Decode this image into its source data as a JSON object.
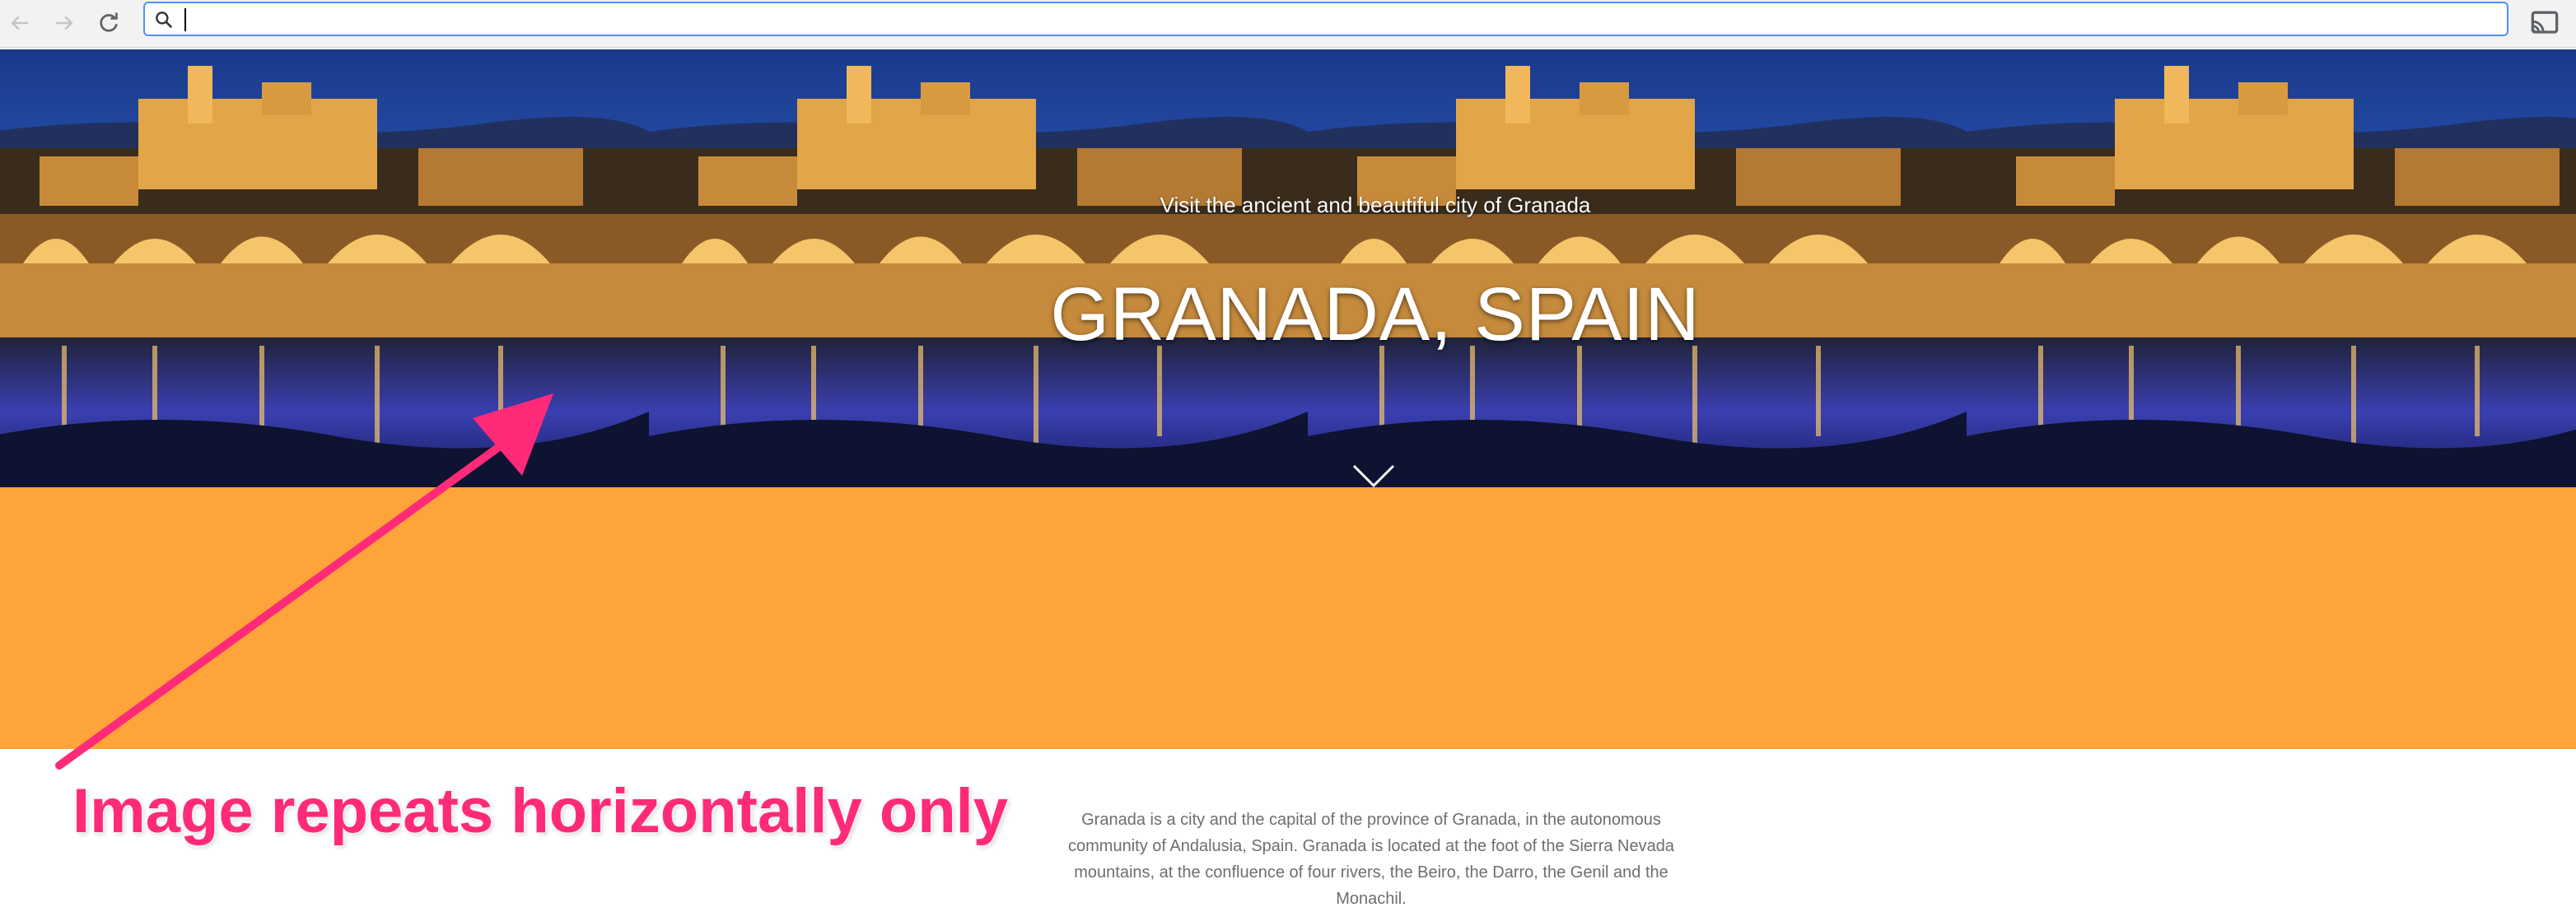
{
  "browser": {
    "back_icon": "back-arrow-icon",
    "forward_icon": "forward-arrow-icon",
    "reload_icon": "reload-icon",
    "address_value": "",
    "search_icon": "search-icon",
    "cast_icon": "cast-icon"
  },
  "hero": {
    "subtitle": "Visit the ancient and beautiful city of Granada",
    "title": "GRANADA, SPAIN",
    "scroll_icon": "chevron-down-icon"
  },
  "band": {
    "color": "#fea43a"
  },
  "description": {
    "text": "Granada is a city and the capital of the province of Granada, in the autonomous community of Andalusia, Spain. Granada is located at the foot of the Sierra Nevada mountains, at the confluence of four rivers, the Beiro, the Darro, the Genil and the Monachil."
  },
  "annotation": {
    "label": "Image repeats horizontally only",
    "color": "#ff2a78"
  }
}
